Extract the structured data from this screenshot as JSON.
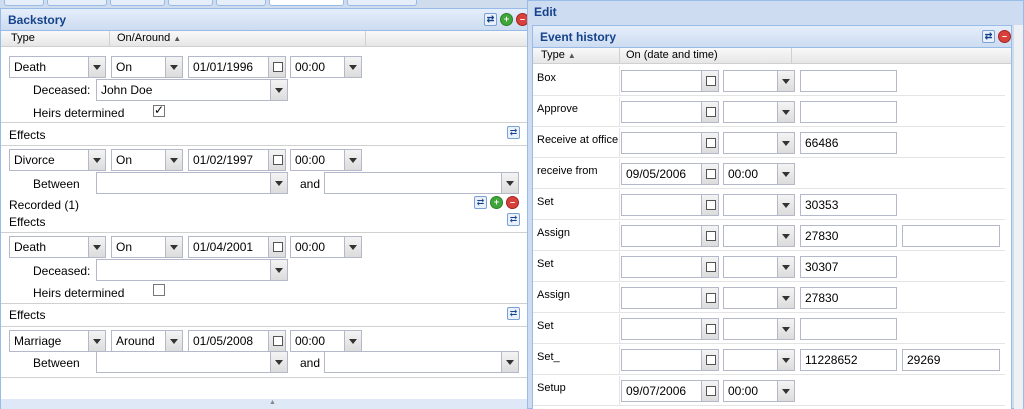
{
  "left": {
    "panel_title": "Backstory",
    "col_type": "Type",
    "col_on": "On/Around",
    "sort_arrow": "▲",
    "blocks": [
      {
        "type": "Death",
        "qualifier": "On",
        "date": "01/01/1996",
        "time": "00:00",
        "sub_label": "Deceased:",
        "sub_value": "John Doe",
        "heirs_label": "Heirs determined",
        "heirs_checked": "✓"
      },
      {
        "type": "Divorce",
        "qualifier": "On",
        "date": "01/02/1997",
        "time": "00:00",
        "between_label": "Between",
        "and_label": "and"
      },
      {
        "type": "Death",
        "qualifier": "On",
        "date": "01/04/2001",
        "time": "00:00",
        "sub_label": "Deceased:",
        "sub_value": "",
        "heirs_label": "Heirs determined",
        "heirs_checked": ""
      },
      {
        "type": "Marriage",
        "qualifier": "Around",
        "date": "01/05/2008",
        "time": "00:00",
        "between_label": "Between",
        "and_label": "and"
      }
    ],
    "effects_label": "Effects",
    "recorded_label": "Recorded (1)"
  },
  "edit": {
    "window_title": "Edit",
    "panel_title": "Event history",
    "col_type": "Type",
    "sort_arrow": "▲",
    "col_on": "On (date and time)",
    "rows": [
      {
        "label": "Box",
        "date": "",
        "time": "",
        "v1": "",
        "v2": null
      },
      {
        "label": "Approve",
        "date": "",
        "time": "",
        "v1": "",
        "v2": null
      },
      {
        "label": "Receive at office",
        "date": "",
        "time": "",
        "v1": "66486",
        "v2": null
      },
      {
        "label": "receive from",
        "date": "09/05/2006",
        "time": "00:00",
        "v1": null,
        "v2": null
      },
      {
        "label": "Set",
        "date": "",
        "time": "",
        "v1": "30353",
        "v2": null
      },
      {
        "label": "Assign",
        "date": "",
        "time": "",
        "v1": "27830",
        "v2": ""
      },
      {
        "label": "Set",
        "date": "",
        "time": "",
        "v1": "30307",
        "v2": null
      },
      {
        "label": "Assign",
        "date": "",
        "time": "",
        "v1": "27830",
        "v2": null
      },
      {
        "label": "Set",
        "date": "",
        "time": "",
        "v1": "",
        "v2": null
      },
      {
        "label": "Set_",
        "date": "",
        "time": "",
        "v1": "11228652",
        "v2": "29269"
      },
      {
        "label": "Setup",
        "date": "09/07/2006",
        "time": "00:00",
        "v1": null,
        "v2": null
      }
    ]
  }
}
